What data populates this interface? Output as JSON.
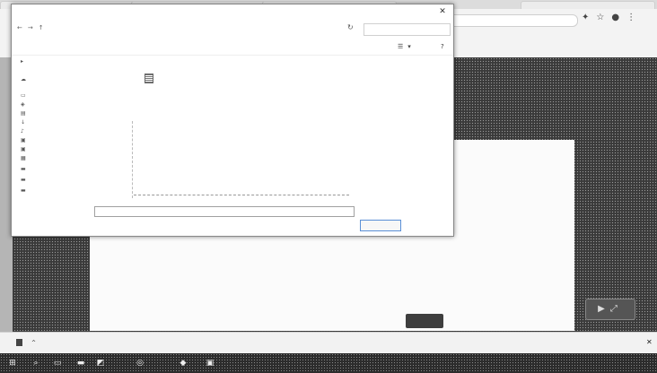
{
  "browser": {
    "tabs": [
      "",
      "",
      "",
      ""
    ],
    "address": "",
    "bookmarks": [
      "",
      "",
      ""
    ],
    "icons": [
      "extensions-icon",
      "star-icon",
      "profile-icon",
      "menu-icon"
    ]
  },
  "web_page": {
    "heading": "",
    "field_label": "",
    "field_value": "",
    "button": ""
  },
  "save_dialog": {
    "title": "",
    "breadcrumb": "",
    "search_placeholder": "",
    "organize": "",
    "new_folder": "",
    "nav_items": [
      "",
      "",
      "",
      "",
      "",
      "",
      "",
      "",
      "",
      "",
      "",
      "",
      "",
      "",
      "",
      ""
    ],
    "columns": [
      "",
      "",
      "",
      ""
    ],
    "file": {
      "name": "",
      "date": "",
      "type": "",
      "size": ""
    },
    "list_status": "",
    "filename_label": "",
    "filename_value": "",
    "save_label": "",
    "save_button": "",
    "cancel_button": ""
  },
  "download_shelf": {
    "item": "",
    "show_all": ""
  },
  "taskbar": {
    "weather": "",
    "time": "",
    "date": ""
  }
}
